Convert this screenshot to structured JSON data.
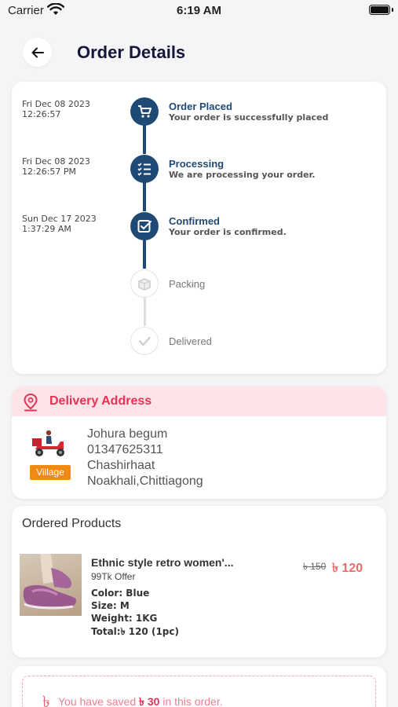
{
  "status_bar": {
    "carrier": "Carrier",
    "time": "6:19 AM"
  },
  "header": {
    "title": "Order Details",
    "back_icon": "arrow-left-icon"
  },
  "timeline": [
    {
      "date": "Fri Dec 08 2023",
      "time": "12:26:57",
      "title": "Order Placed",
      "subtitle": "Your order is successfully placed",
      "icon": "cart-icon",
      "done": true
    },
    {
      "date": "Fri Dec 08 2023",
      "time": "12:26:57 PM",
      "title": "Processing",
      "subtitle": "We are processing your order.",
      "icon": "checklist-icon",
      "done": true
    },
    {
      "date": "Sun Dec 17 2023",
      "time": "1:37:29 AM",
      "title": "Confirmed",
      "subtitle": "Your order is confirmed.",
      "icon": "checkbox-icon",
      "done": true
    },
    {
      "title": "Packing",
      "icon": "box-icon",
      "done": false
    },
    {
      "title": "Delivered",
      "icon": "check-icon",
      "done": false
    }
  ],
  "delivery": {
    "title": "Delivery Address",
    "badge": "Village",
    "name": "Johura begum",
    "phone": "01347625311",
    "area": "Chashirhaat",
    "city": "Noakhali,Chittiagong"
  },
  "products": {
    "title": "Ordered Products",
    "items": [
      {
        "name": "Ethnic style retro women'...",
        "offer": "99Tk Offer",
        "old_price": "৳ 150",
        "price": "৳ 120",
        "color": "Color: Blue",
        "size": "Size: M",
        "weight": "Weight: 1KG",
        "total": "Total:৳ 120 (1pc)"
      }
    ]
  },
  "savings": {
    "prefix": "You have saved ",
    "amount": "৳ 30",
    "suffix": " in this order.",
    "icon": "taka-icon"
  },
  "colors": {
    "primary": "#1f4a76",
    "accent": "#e83155",
    "badge": "#f08a13",
    "price": "#ef6a6a"
  }
}
